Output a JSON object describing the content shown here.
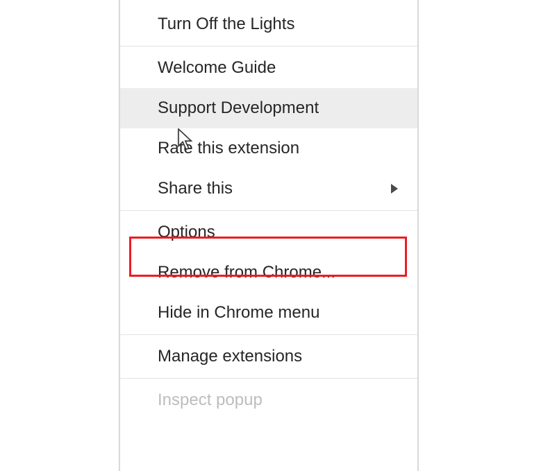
{
  "menu": {
    "items": [
      {
        "label": "Turn Off the Lights",
        "has_submenu": false,
        "hovered": false,
        "disabled": false
      },
      {
        "label": "Welcome Guide",
        "has_submenu": false,
        "hovered": false,
        "disabled": false
      },
      {
        "label": "Support Development",
        "has_submenu": false,
        "hovered": true,
        "disabled": false
      },
      {
        "label": "Rate this extension",
        "has_submenu": false,
        "hovered": false,
        "disabled": false
      },
      {
        "label": "Share this",
        "has_submenu": true,
        "hovered": false,
        "disabled": false
      },
      {
        "label": "Options",
        "has_submenu": false,
        "hovered": false,
        "disabled": false,
        "highlighted": true
      },
      {
        "label": "Remove from Chrome...",
        "has_submenu": false,
        "hovered": false,
        "disabled": false
      },
      {
        "label": "Hide in Chrome menu",
        "has_submenu": false,
        "hovered": false,
        "disabled": false
      },
      {
        "label": "Manage extensions",
        "has_submenu": false,
        "hovered": false,
        "disabled": false
      },
      {
        "label": "Inspect popup",
        "has_submenu": false,
        "hovered": false,
        "disabled": true
      }
    ]
  },
  "highlight_color": "#ed1c24"
}
